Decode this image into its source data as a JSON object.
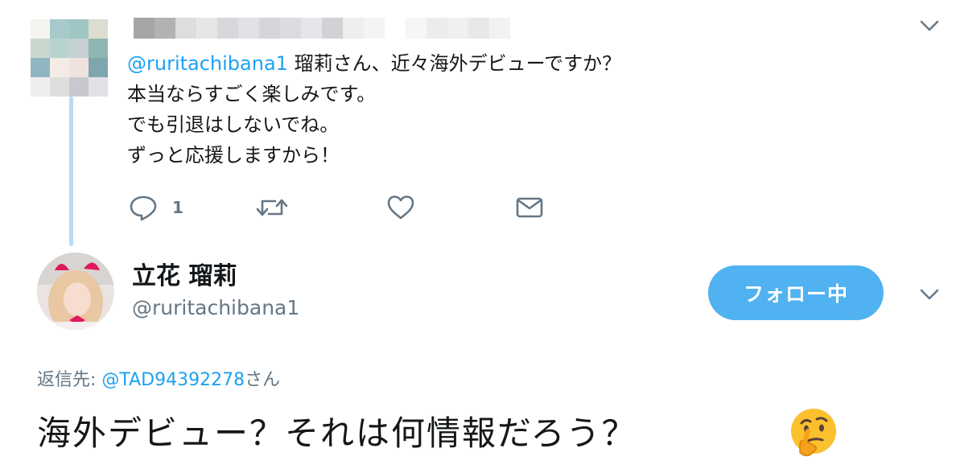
{
  "reply_tweet": {
    "mention": "@ruritachibana1",
    "line1_rest": " 瑠莉さん、近々海外デビューですか？",
    "line2": "本当ならすごく楽しみです。",
    "line3": "でも引退はしないでね。",
    "line4": "ずっと応援しますから！",
    "actions": {
      "reply_icon": "reply-icon",
      "reply_count": "1",
      "retweet_icon": "retweet-icon",
      "like_icon": "heart-icon",
      "dm_icon": "envelope-icon"
    }
  },
  "main_tweet": {
    "display_name": "立花 瑠莉",
    "screen_name": "@ruritachibana1",
    "follow_label": "フォロー中",
    "reply_to_label": "返信先: ",
    "reply_to_mention": "@TAD94392278",
    "reply_to_suffix": "さん",
    "text": "海外デビュー？それは何情報だろう？",
    "emoji": "thinking-face-emoji"
  },
  "colors": {
    "accent": "#1da1f2",
    "follow_button": "#50b2f0",
    "thread_line": "#b7dbf4",
    "secondary_text": "#657786"
  }
}
